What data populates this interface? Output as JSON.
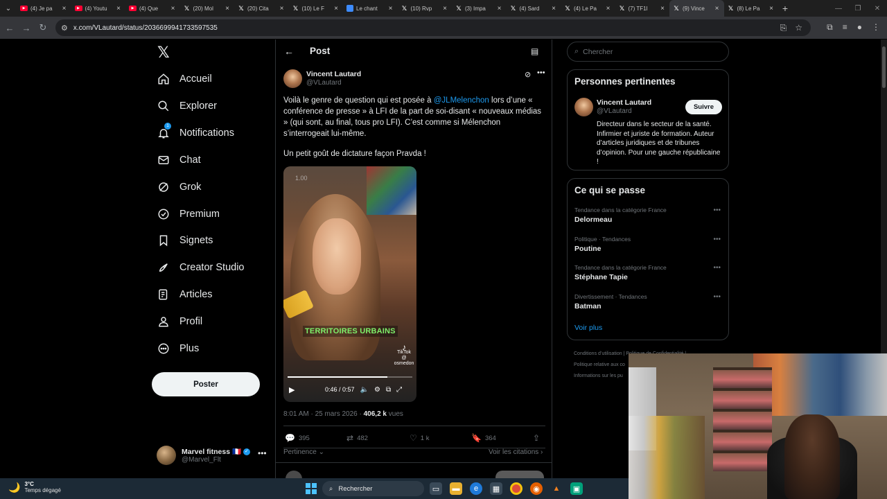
{
  "browser": {
    "tabs": [
      {
        "icon": "youtube-icon",
        "title": "(4) Je pa"
      },
      {
        "icon": "youtube-icon",
        "title": "(4) Youtu"
      },
      {
        "icon": "youtube-icon",
        "title": "(4) Que"
      },
      {
        "icon": "x-icon",
        "title": "(20) Mol"
      },
      {
        "icon": "x-icon",
        "title": "(20) Cita"
      },
      {
        "icon": "x-icon",
        "title": "(10) Le F"
      },
      {
        "icon": "web-icon",
        "title": "Le chant"
      },
      {
        "icon": "x-icon",
        "title": "(10) Rvp"
      },
      {
        "icon": "x-icon",
        "title": "(3) Impa"
      },
      {
        "icon": "x-icon",
        "title": "(4) Sard"
      },
      {
        "icon": "x-icon",
        "title": "(4) Le Pa"
      },
      {
        "icon": "x-icon",
        "title": "(7) TF1l"
      },
      {
        "icon": "x-icon",
        "title": "(9) Vince",
        "active": true
      },
      {
        "icon": "x-icon",
        "title": "(8) Le Pa"
      }
    ],
    "url": "x.com/VLautard/status/2036699941733597535"
  },
  "nav": {
    "items": [
      {
        "label": "Accueil",
        "icon": "home-icon"
      },
      {
        "label": "Explorer",
        "icon": "search-icon"
      },
      {
        "label": "Notifications",
        "icon": "bell-icon",
        "badge": "1"
      },
      {
        "label": "Chat",
        "icon": "mail-icon"
      },
      {
        "label": "Grok",
        "icon": "grok-icon"
      },
      {
        "label": "Premium",
        "icon": "premium-icon"
      },
      {
        "label": "Signets",
        "icon": "bookmark-icon"
      },
      {
        "label": "Creator Studio",
        "icon": "rocket-icon"
      },
      {
        "label": "Articles",
        "icon": "articles-icon"
      },
      {
        "label": "Profil",
        "icon": "user-icon"
      },
      {
        "label": "Plus",
        "icon": "more-circle-icon"
      }
    ],
    "post_button": "Poster",
    "account": {
      "name": "Marvel fitness 🇫🇷",
      "handle": "@Marvel_Flt"
    }
  },
  "post": {
    "header_title": "Post",
    "author_name": "Vincent Lautard",
    "author_handle": "@VLautard",
    "text_before": "Voilà le genre de question qui est posée à ",
    "mention": "@JLMelenchon",
    "text_after": " lors d’une « conférence de presse » à LFI de la part de soi-disant « nouveaux médias » (qui sont, au final, tous pro LFI). C’est comme si Mélenchon s’interrogeait lui-même.",
    "text2": "Un petit goût de dictature façon Pravda !",
    "video": {
      "speed": "1.00",
      "caption": "TERRITOIRES URBAINS",
      "watermark": "TikTok",
      "watermark_user": "@ osmedon",
      "time": "0:46 / 0:57",
      "progress": 0.8
    },
    "time": "8:01 AM · 25 mars 2026",
    "views_count": "406,2 k",
    "views_label": "vues",
    "stats": {
      "replies": "395",
      "reposts": "482",
      "likes": "1 k",
      "bookmarks": "364"
    },
    "sort_label": "Pertinence",
    "quotes_label": "Voir les citations"
  },
  "sidebar": {
    "search_placeholder": "Chercher",
    "relevant": {
      "title": "Personnes pertinentes",
      "name": "Vincent Lautard",
      "handle": "@VLautard",
      "follow_label": "Suivre",
      "bio": "Directeur dans le secteur de la santé. Infirmier et juriste de formation. Auteur d’articles juridiques et de tribunes d’opinion. Pour une gauche républicaine !"
    },
    "trends": {
      "title": "Ce qui se passe",
      "items": [
        {
          "category": "Tendance dans la catégorie France",
          "name": "Delormeau"
        },
        {
          "category": "Politique · Tendances",
          "name": "Poutine"
        },
        {
          "category": "Tendance dans la catégorie France",
          "name": "Stéphane Tapie"
        },
        {
          "category": "Divertissement · Tendances",
          "name": "Batman"
        }
      ],
      "see_more": "Voir plus"
    },
    "footer": [
      "Conditions d’utilisation  |  Politique de Confidentialité  |",
      "Politique relative aux co",
      "Informations sur les pu"
    ]
  },
  "taskbar": {
    "temp": "3°C",
    "weather": "Temps dégagé",
    "search": "Rechercher"
  }
}
